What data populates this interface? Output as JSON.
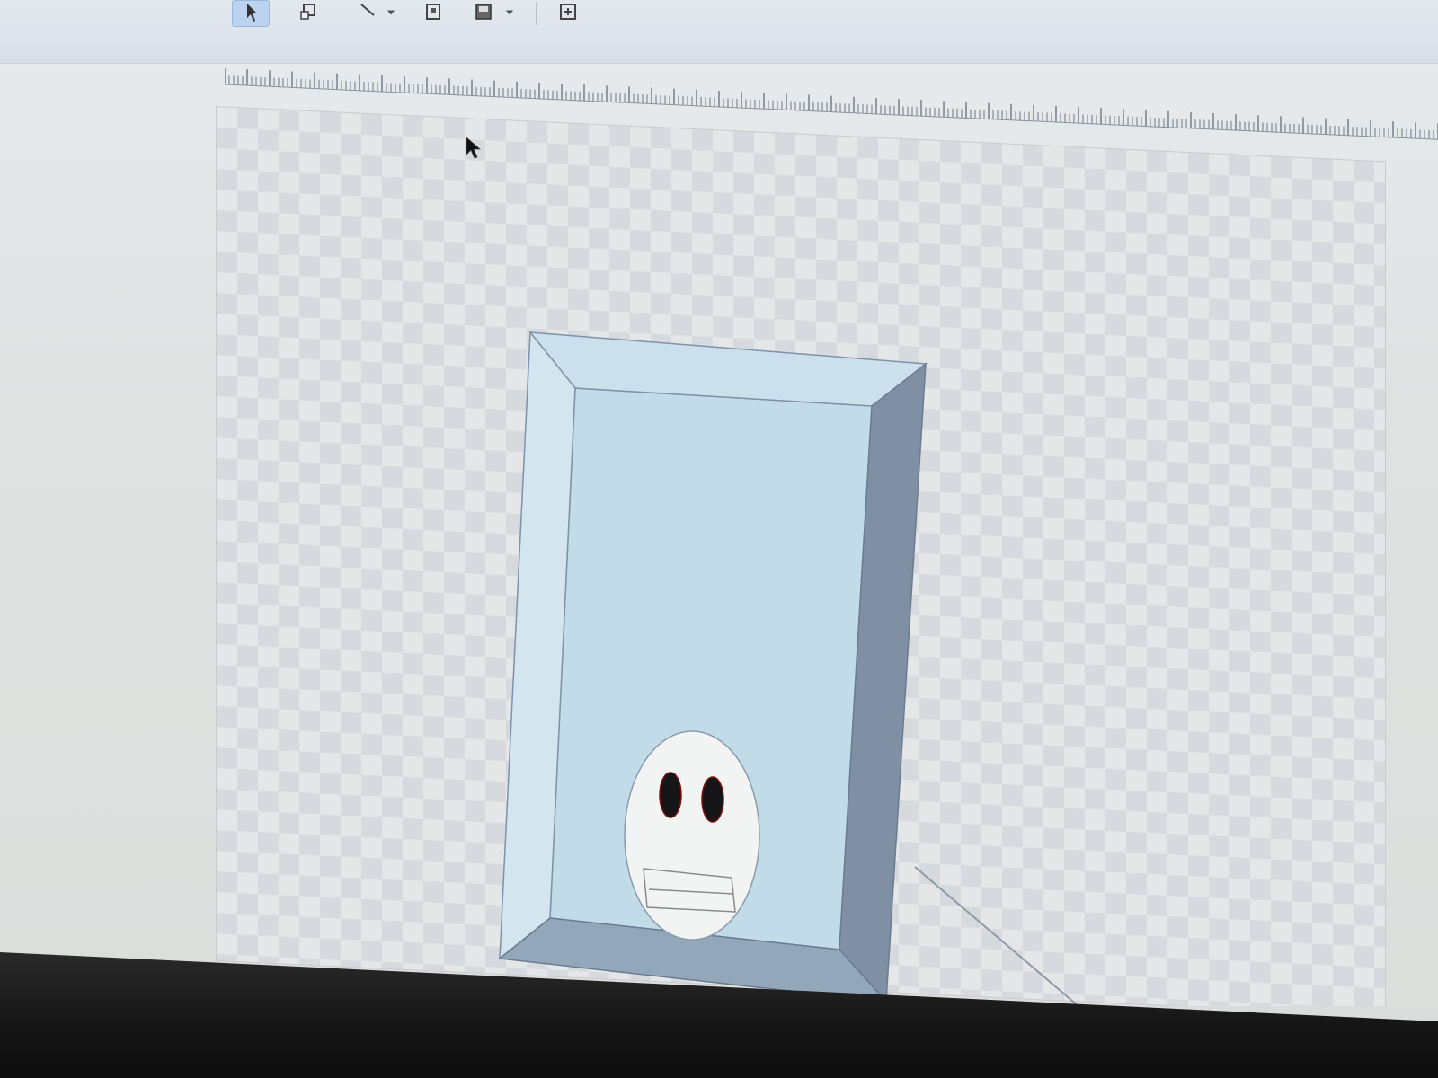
{
  "toolbar": {
    "tools": [
      {
        "id": "select",
        "icon": "pointer-arrow-icon",
        "active": true
      },
      {
        "id": "node-edit",
        "icon": "node-edit-icon",
        "active": false
      },
      {
        "id": "line",
        "icon": "line-tool-icon",
        "active": false,
        "has_dropdown": true
      },
      {
        "id": "crop",
        "icon": "crop-frame-icon",
        "active": false
      },
      {
        "id": "fill",
        "icon": "fill-box-icon",
        "active": false,
        "has_dropdown": true
      },
      {
        "id": "insert",
        "icon": "insert-object-icon",
        "active": false
      }
    ]
  },
  "canvas": {
    "background": "transparency-checkerboard",
    "objects": [
      {
        "type": "beveled-rectangle",
        "face_color": "#bfd9e8",
        "edge_colors": [
          "#cfe1ec",
          "#8fa3b7",
          "#7e8fa3"
        ]
      },
      {
        "type": "face-oval",
        "fill": "#f2f3f3",
        "eyes": 2,
        "mouth": "rectangle"
      },
      {
        "type": "line"
      }
    ]
  },
  "colors": {
    "accent": "#bcd3ef",
    "toolbar_bg": "#dde3ec",
    "checker_dark": "#d6d9de",
    "checker_light": "#e4e6e8"
  }
}
